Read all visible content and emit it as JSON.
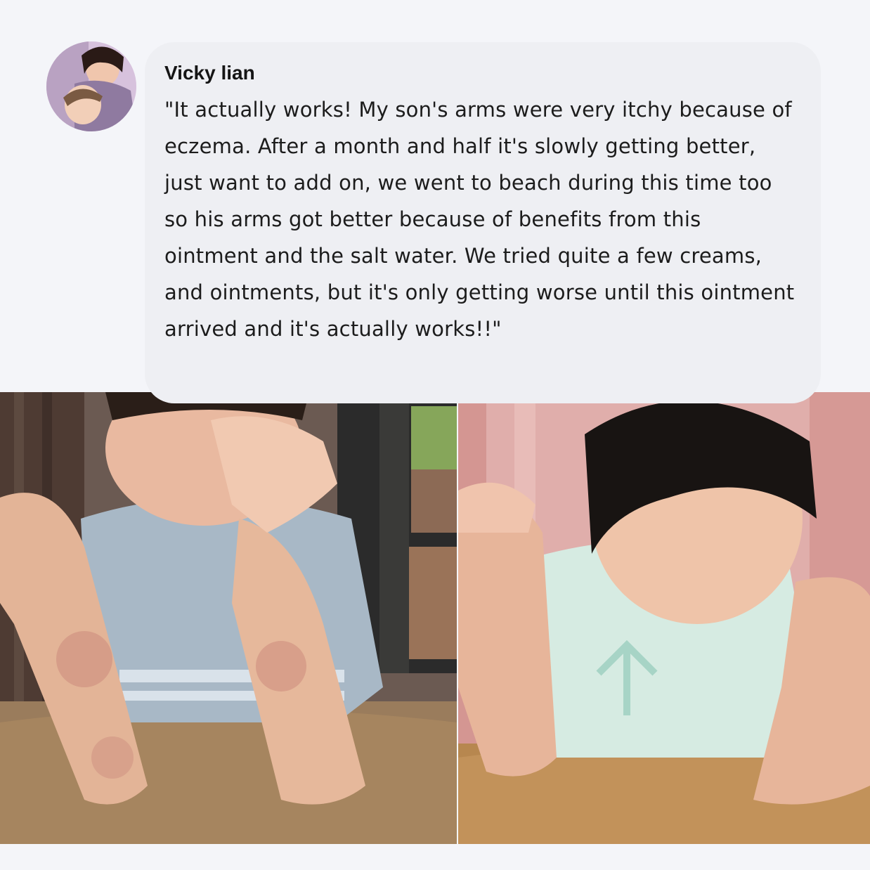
{
  "review": {
    "author_name": "Vicky lian",
    "text": "\"It actually works! My son's arms were very itchy because of eczema. After a month and half it's slowly getting better, just want to add on, we went to beach during this time too so his arms got better because of benefits from this ointment and the salt water. We tried quite a few creams, and ointments, but it's only getting worse until this ointment arrived and it's actually works!!\""
  },
  "colors": {
    "page_background": "#f4f5f9",
    "bubble_background": "#eeeff3",
    "text": "#1c1c1c"
  },
  "images": {
    "avatar": "avatar-photo",
    "before": "before-photo",
    "after": "after-photo"
  }
}
